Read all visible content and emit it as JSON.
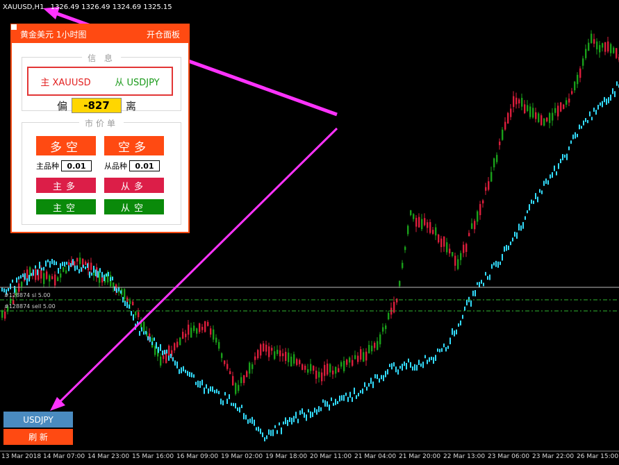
{
  "header": {
    "symbol": "XAUUSD,H1",
    "ohlc": "1326.49 1326.49 1324.69 1325.15"
  },
  "panel": {
    "title_left": "黄金美元 1小时图",
    "title_right": "开仓面板",
    "info_group": {
      "legend": "信 息",
      "main_symbol": "主 XAUUSD",
      "sub_symbol": "从 USDJPY",
      "deviation_left": "偏",
      "deviation_value": "-827",
      "deviation_right": "离"
    },
    "market_group": {
      "legend": "市价单",
      "long_short_button": "多空",
      "short_long_button": "空多",
      "main_lot_label": "主品种",
      "main_lot_value": "0.01",
      "sub_lot_label": "从品种",
      "sub_lot_value": "0.01",
      "main_long_button": "主多",
      "sub_long_button": "从多",
      "main_short_button": "主空",
      "sub_short_button": "从空"
    }
  },
  "side_buttons": {
    "usdjpy_button": "USDJPY",
    "refresh_button": "刷 新"
  },
  "price_lines": {
    "line1_label": "#128874 sl 5.00",
    "line2_label": "#128874 sell 5.00"
  },
  "time_axis": [
    "13 Mar 2018",
    "14 Mar 07:00",
    "14 Mar 23:00",
    "15 Mar 16:00",
    "16 Mar 09:00",
    "19 Mar 02:00",
    "19 Mar 18:00",
    "20 Mar 11:00",
    "21 Mar 04:00",
    "21 Mar 20:00",
    "22 Mar 13:00",
    "23 Mar 06:00",
    "23 Mar 22:00",
    "26 Mar 15:00"
  ],
  "colors": {
    "panel_accent": "#ff4a12",
    "bull_candle": "#1aa01a",
    "bear_candle": "#dc1e3c",
    "overlay_line": "#33ddff",
    "annotation_arrow": "#ff33ff"
  }
}
